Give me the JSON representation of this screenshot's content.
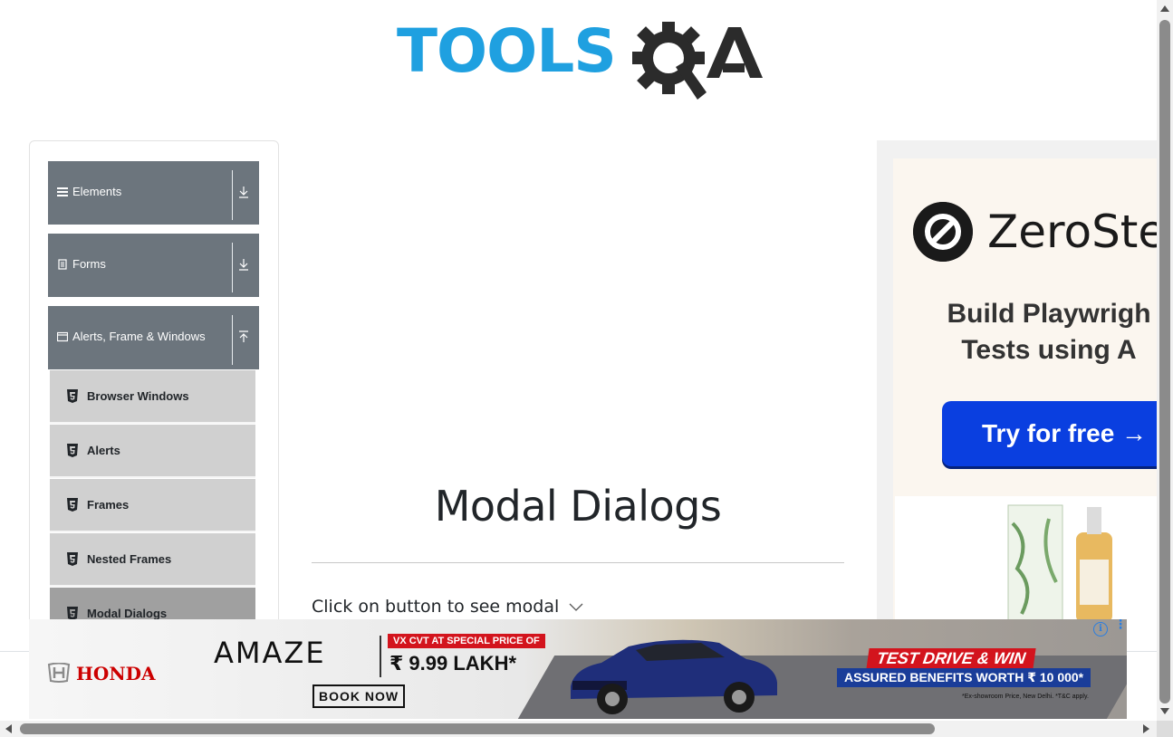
{
  "header": {
    "logo_text": "TOOLS",
    "logo_suffix": "A"
  },
  "sidebar": {
    "groups": [
      {
        "label": "Elements",
        "icon": "hamburger-icon",
        "arrow": "download-icon"
      },
      {
        "label": "Forms",
        "icon": "form-icon",
        "arrow": "download-icon"
      },
      {
        "label": "Alerts, Frame & Windows",
        "icon": "window-icon",
        "arrow": "upload-icon"
      }
    ],
    "items": [
      {
        "label": "Browser Windows",
        "icon": "html5-icon"
      },
      {
        "label": "Alerts",
        "icon": "html5-icon"
      },
      {
        "label": "Frames",
        "icon": "html5-icon"
      },
      {
        "label": "Nested Frames",
        "icon": "html5-icon"
      },
      {
        "label": "Modal Dialogs",
        "icon": "html5-icon",
        "active": true
      }
    ]
  },
  "main": {
    "title": "Modal Dialogs",
    "instruction": "Click on button to see modal"
  },
  "right_ad": {
    "brand": "ZeroSte",
    "tagline_line1": "Build Playwrigh",
    "tagline_line2": "Tests using A",
    "cta": "Try for free →",
    "cta_color": "#0a3fe0"
  },
  "bottom_ad": {
    "brand": "HONDA",
    "model": "AMAZE",
    "badge": "VX CVT AT SPECIAL PRICE OF",
    "price": "₹ 9.99 LAKH*",
    "book": "BOOK NOW",
    "test_drive": "TEST DRIVE & WIN",
    "benefits": "ASSURED BENEFITS WORTH ₹ 10 000*",
    "fine_print": "*Ex-showroom Price, New Delhi. *T&C apply.",
    "info_label": "i",
    "menu_label": "⋮"
  },
  "colors": {
    "logo_blue": "#1fa0e0",
    "sidebar_header": "#6c757d",
    "sidebar_item": "#d0d0d0",
    "sidebar_item_active": "#a0a0a0",
    "honda_red": "#cc0000"
  }
}
